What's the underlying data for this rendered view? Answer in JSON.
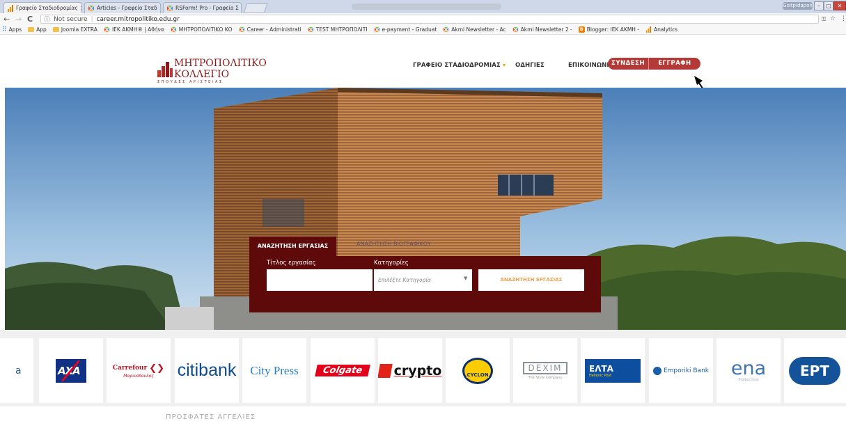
{
  "browser": {
    "tabs": [
      {
        "title": "Γραφείο Σταδιοδρομίας",
        "close": "×"
      },
      {
        "title": "Articles - Γραφείο Σταδ",
        "close": "×"
      },
      {
        "title": "RSForm! Pro - Γραφείο Σ",
        "close": "×"
      }
    ],
    "window_user": "Goitpidapon",
    "nav": {
      "back": "←",
      "forward": "→",
      "reload": "C"
    },
    "security_label": "Not secure",
    "url": "career.mitropolitiko.edu.gr",
    "bookmarks": [
      {
        "label": "Apps",
        "icon": "apps-icon"
      },
      {
        "label": "App",
        "icon": "folder-icon"
      },
      {
        "label": "Joomla EXTRA",
        "icon": "folder-icon"
      },
      {
        "label": "ΙΕΚ ΑΚΜΗ® | Αθήνα",
        "icon": "joomla-icon"
      },
      {
        "label": "ΜΗΤΡΟΠΟΛΙΤΙΚΟ ΚΟ",
        "icon": "joomla-icon"
      },
      {
        "label": "Career - Administrati",
        "icon": "joomla-icon"
      },
      {
        "label": "TEST ΜΗΤΡΟΠΟΛΙΤΙ",
        "icon": "joomla-icon"
      },
      {
        "label": "e-payment - Graduat",
        "icon": "joomla-icon"
      },
      {
        "label": "Akmi Newsletter - Ac",
        "icon": "joomla-icon"
      },
      {
        "label": "Akmi Newsletter 2 -",
        "icon": "joomla-icon"
      },
      {
        "label": "Blogger: ΙΕΚ ΑΚΜΗ -",
        "icon": "blogger-icon"
      },
      {
        "label": "Analytics",
        "icon": "analytics-icon"
      }
    ]
  },
  "site": {
    "logo": {
      "line1": "ΜΗΤΡΟΠΟΛΙΤΙΚΟ",
      "line2": "ΚΟΛΛΕΓΙΟ",
      "line3": "ΣΠΟΥΔΕΣ ΑΡΙΣΤΕΙΑΣ"
    },
    "nav": {
      "career_office": "ΓΡΑΦΕΙΟ ΣΤΑΔΙΟΔΡΟΜΙΑΣ",
      "instructions": "ΟΔΗΓΙΕΣ",
      "contact": "ΕΠΙΚΟΙΝΩΝΙΑ",
      "login": "ΣΥΝΔΕΣΗ",
      "register": "ΕΓΓΡΑΦΗ"
    },
    "search": {
      "tab_jobs": "ΑΝΑΖΗΤΗΣΗ ΕΡΓΑΣΙΑΣ",
      "tab_other": "ΑΝΑΖΗΤΗΣΗ ΒΙΟΓΡΑΦΙΚΟΥ",
      "label_title": "Τίτλος εργασίας",
      "label_category": "Κατηγορίες",
      "title_value": "",
      "category_placeholder": "Επιλέξτε Κατηγορία",
      "button": "ΑΝΑΖΗΤΗΣΗ ΕΡΓΑΣΙΑΣ"
    },
    "partners": [
      "a",
      "AXA",
      "Carrefour",
      "Μαρινόπουλος",
      "citibank",
      "City Press",
      "Colgate",
      "crypto",
      "CYCLON",
      "DEXIM",
      "The Style Company",
      "ΕΛΤΑ",
      "Hellenic Post",
      "Emporiki Bank",
      "ena",
      "Productions",
      "EPT"
    ],
    "section_title": "ΠΡΟΣΦΑΤΕΣ ΑΓΓΕΛΙΕΣ"
  },
  "colors": {
    "brand": "#b33a36",
    "panel": "#5e0a0a",
    "accent": "#f0a000"
  }
}
